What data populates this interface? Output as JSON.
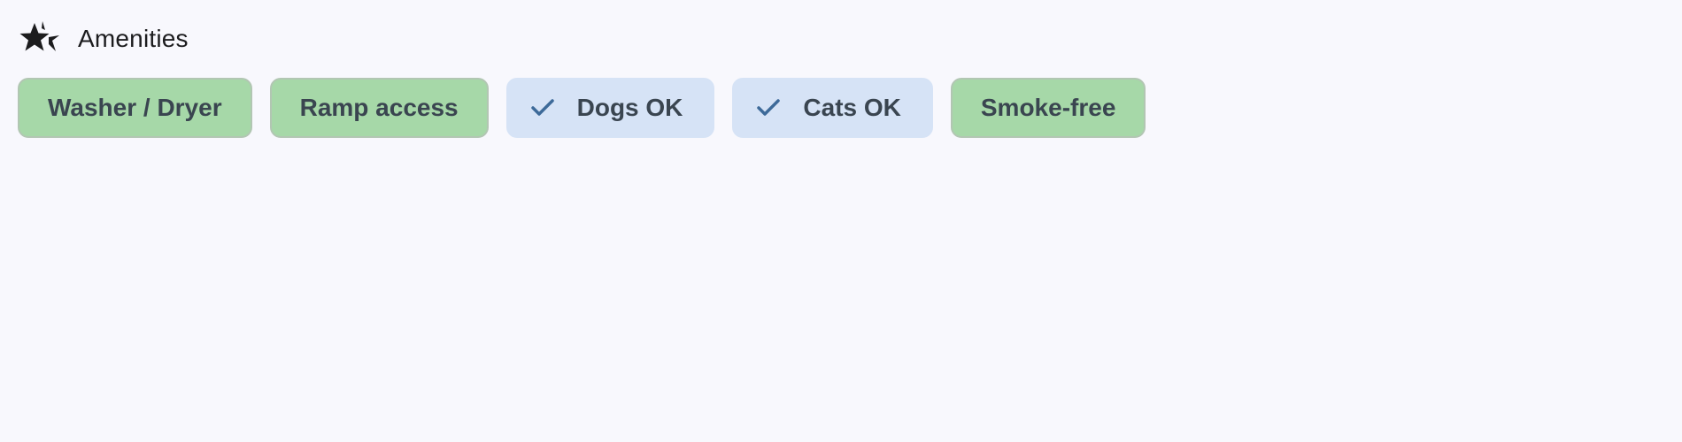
{
  "section": {
    "title": "Amenities",
    "icon": "sparkle-stars-icon"
  },
  "chips": [
    {
      "label": "Washer / Dryer",
      "selected": false,
      "color": "#a6d8a8"
    },
    {
      "label": "Ramp access",
      "selected": false,
      "color": "#a6d8a8"
    },
    {
      "label": "Dogs OK",
      "selected": true,
      "color": "#d6e3f6",
      "icon": "check-icon"
    },
    {
      "label": "Cats OK",
      "selected": true,
      "color": "#d6e3f6",
      "icon": "check-icon"
    },
    {
      "label": "Smoke-free",
      "selected": false,
      "color": "#a6d8a8"
    }
  ],
  "colors": {
    "background": "#f8f8fd",
    "check": "#3d6a99",
    "text": "#3a4550"
  }
}
